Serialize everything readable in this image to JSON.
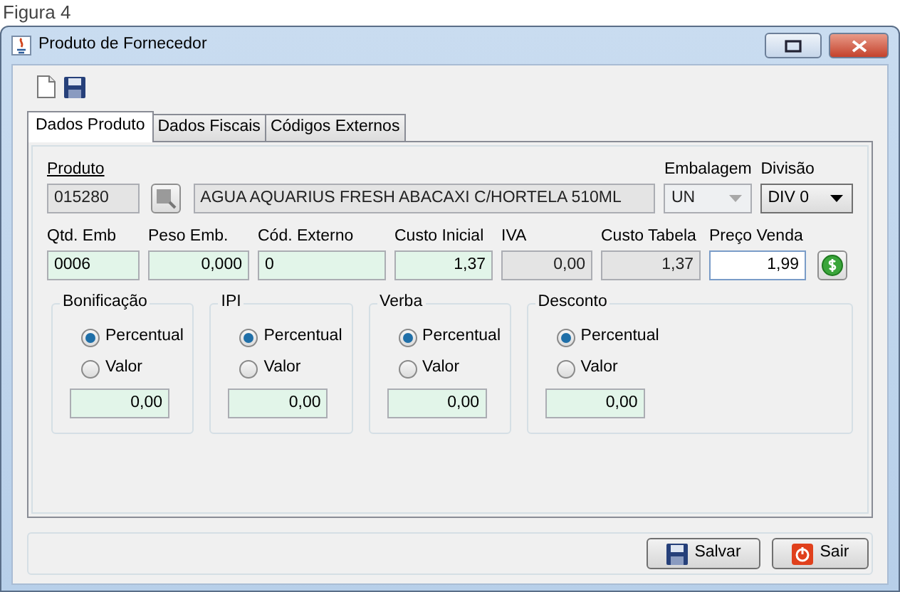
{
  "caption": "Figura 4",
  "window": {
    "title": "Produto de Fornecedor"
  },
  "tabs": [
    {
      "label": "Dados Produto",
      "selected": true
    },
    {
      "label": "Dados Fiscais",
      "selected": false
    },
    {
      "label": "Códigos Externos",
      "selected": false
    }
  ],
  "product": {
    "label": "Produto",
    "code": "015280",
    "description": "AGUA AQUARIUS FRESH ABACAXI C/HORTELA 510ML",
    "packaging": {
      "label": "Embalagem",
      "value": "UN",
      "disabled": true
    },
    "division": {
      "label": "Divisão",
      "value": "DIV 0",
      "disabled": false
    }
  },
  "fields": [
    {
      "label": "Qtd. Emb",
      "value": "0006",
      "kind": "text",
      "editable": true,
      "focused": false
    },
    {
      "label": "Peso Emb.",
      "value": "0,000",
      "kind": "number",
      "editable": true,
      "focused": false
    },
    {
      "label": "Cód. Externo",
      "value": "0",
      "kind": "text",
      "editable": true,
      "focused": false
    },
    {
      "label": "Custo Inicial",
      "value": "1,37",
      "kind": "number",
      "editable": true,
      "focused": false
    },
    {
      "label": "IVA",
      "value": "0,00",
      "kind": "number",
      "editable": false,
      "focused": false
    },
    {
      "label": "Custo Tabela",
      "value": "1,37",
      "kind": "number",
      "editable": false,
      "focused": false
    },
    {
      "label": "Preço Venda",
      "value": "1,99",
      "kind": "number",
      "editable": true,
      "focused": true
    }
  ],
  "groups": [
    {
      "title": "Bonificação",
      "options": [
        {
          "label": "Percentual",
          "selected": true
        },
        {
          "label": "Valor",
          "selected": false
        }
      ],
      "value": "0,00"
    },
    {
      "title": "IPI",
      "options": [
        {
          "label": "Percentual",
          "selected": true
        },
        {
          "label": "Valor",
          "selected": false
        }
      ],
      "value": "0,00"
    },
    {
      "title": "Verba",
      "options": [
        {
          "label": "Percentual",
          "selected": true
        },
        {
          "label": "Valor",
          "selected": false
        }
      ],
      "value": "0,00"
    },
    {
      "title": "Desconto",
      "options": [
        {
          "label": "Percentual",
          "selected": true
        },
        {
          "label": "Valor",
          "selected": false
        }
      ],
      "value": "0,00"
    }
  ],
  "buttons": [
    {
      "label": "Salvar",
      "kind": "save"
    },
    {
      "label": "Sair",
      "kind": "exit"
    }
  ]
}
